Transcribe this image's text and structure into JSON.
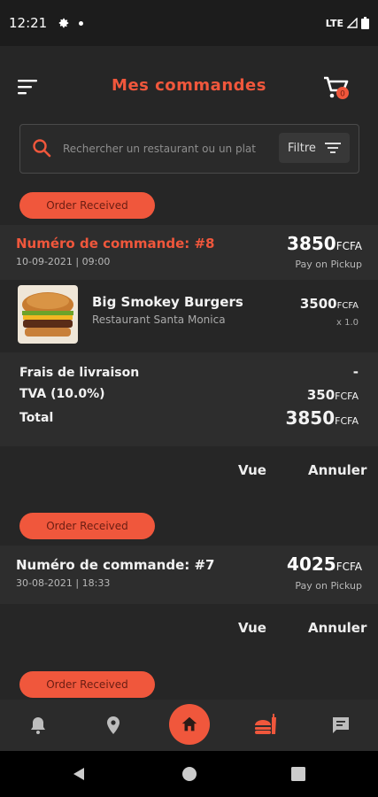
{
  "status_bar": {
    "time": "12:21",
    "network": "LTE"
  },
  "header": {
    "title": "Mes commandes"
  },
  "search": {
    "placeholder": "Rechercher un restaurant ou un plat",
    "filter_label": "Filtre"
  },
  "orders": [
    {
      "status": "Order Received",
      "number_label": "Numéro de commande: #8",
      "date": "10-09-2021 | 09:00",
      "total": "3850",
      "currency": "FCFA",
      "payment": "Pay on Pickup",
      "items": [
        {
          "name": "Big Smokey Burgers",
          "restaurant": "Restaurant Santa Monica",
          "price": "3500",
          "currency": "FCFA",
          "qty": "x 1.0"
        }
      ],
      "summary": {
        "delivery_label": "Frais de livraison",
        "delivery_value": "-",
        "tax_label": "TVA (10.0%)",
        "tax_value": "350",
        "tax_currency": "FCFA",
        "total_label": "Total",
        "total_value": "3850",
        "total_currency": "FCFA"
      },
      "actions": {
        "view": "Vue",
        "cancel": "Annuler"
      }
    },
    {
      "status": "Order Received",
      "number_label": "Numéro de commande: #7",
      "date": "30-08-2021 | 18:33",
      "total": "4025",
      "currency": "FCFA",
      "payment": "Pay on Pickup",
      "actions": {
        "view": "Vue",
        "cancel": "Annuler"
      }
    },
    {
      "status": "Order Received"
    }
  ],
  "cart": {
    "count": "0"
  },
  "bottom_nav": {
    "icons": [
      "bell-icon",
      "location-icon",
      "home-icon",
      "orders-icon",
      "chat-icon"
    ],
    "active": "orders"
  },
  "colors": {
    "accent": "#f0573c",
    "background": "#262626",
    "card": "#2d2d2d"
  }
}
